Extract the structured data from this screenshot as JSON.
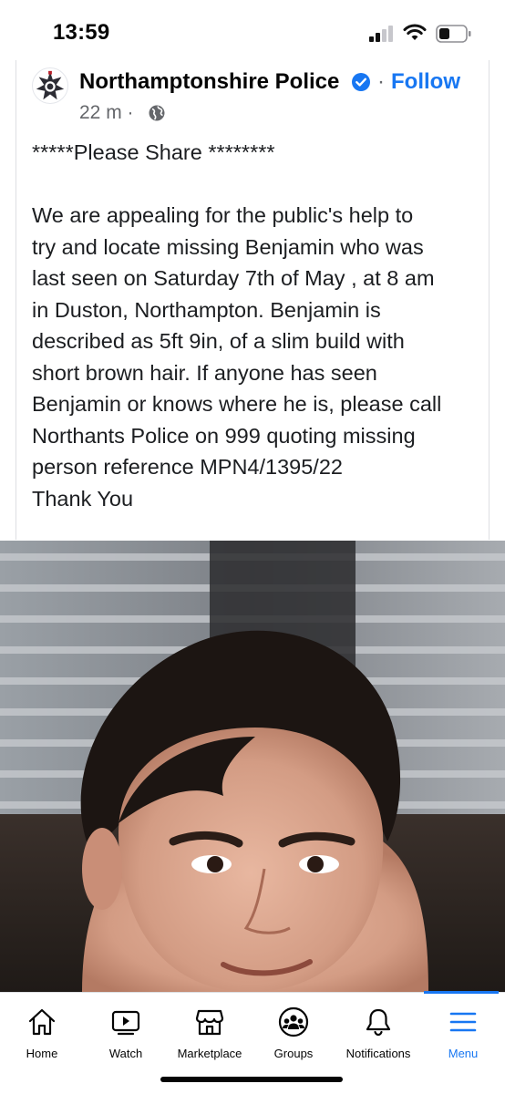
{
  "status_bar": {
    "time": "13:59",
    "icons": [
      "cellular-signal-icon",
      "wifi-icon",
      "battery-icon"
    ]
  },
  "post": {
    "page_name": "Northamptonshire Police",
    "separator": "·",
    "follow_label": "Follow",
    "time_ago": "22 m ·",
    "audience_icon": "globe-icon",
    "text_lines": [
      "*****Please Share ********",
      "",
      "We are appealing for the public's help to",
      "try and locate missing Benjamin who was",
      "last seen on Saturday 7th of May , at 8 am",
      "in Duston, Northampton. Benjamin is",
      "described as 5ft 9in, of a slim build  with",
      "short brown hair. If anyone has seen",
      "Benjamin or knows where he is, please call",
      "Northants Police on 999 quoting missing",
      "person reference MPN4/1395/22",
      "Thank You"
    ]
  },
  "tabbar": {
    "tabs": [
      {
        "label": "Home",
        "icon": "home-icon"
      },
      {
        "label": "Watch",
        "icon": "watch-icon"
      },
      {
        "label": "Marketplace",
        "icon": "marketplace-icon"
      },
      {
        "label": "Groups",
        "icon": "groups-icon"
      },
      {
        "label": "Notifications",
        "icon": "bell-icon"
      },
      {
        "label": "Menu",
        "icon": "menu-icon"
      }
    ],
    "active_tab": "Menu"
  },
  "colors": {
    "accent": "#1877f2",
    "text": "#050505",
    "secondary_text": "#65676b",
    "divider": "#dddfe2"
  }
}
